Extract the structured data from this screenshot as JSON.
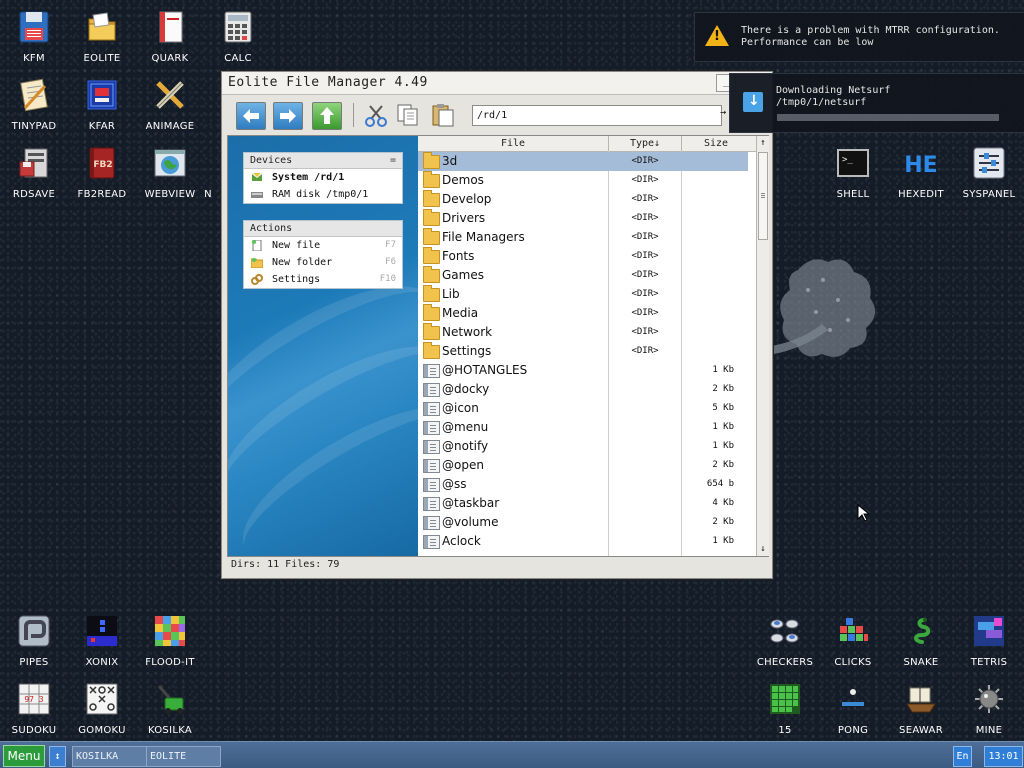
{
  "desktop": {
    "icons_top_left": [
      "KFM",
      "EOLITE",
      "QUARK",
      "CALC",
      "TINYPAD",
      "KFAR",
      "ANIMAGE",
      "RDSAVE",
      "FB2READ",
      "WEBVIEW",
      "N"
    ],
    "icons_top_right": [
      "SHELL",
      "HEXEDIT",
      "SYSPANEL"
    ],
    "icons_bottom_left": [
      "PIPES",
      "XONIX",
      "FLOOD-IT",
      "SUDOKU",
      "GOMOKU",
      "KOSILKA"
    ],
    "icons_bottom_right": [
      "CHECKERS",
      "CLICKS",
      "SNAKE",
      "TETRIS",
      "15",
      "PONG",
      "SEAWAR",
      "MINE"
    ],
    "hexedit_glyph": "HE",
    "fb2_glyph": "FB2",
    "sudoku_glyph": "97 3",
    "shell_glyph": ">_"
  },
  "window": {
    "title": "Eolite File Manager 4.49",
    "min_label": "_",
    "address": "/rd/1",
    "go_label": "→",
    "devices": {
      "header": "Devices",
      "mark": "=",
      "items": [
        {
          "label": "System /rd/1"
        },
        {
          "label": "RAM disk /tmp0/1"
        }
      ]
    },
    "actions": {
      "header": "Actions",
      "items": [
        {
          "label": "New file",
          "key": "F7"
        },
        {
          "label": "New folder",
          "key": "F6"
        },
        {
          "label": "Settings",
          "key": "F10"
        }
      ]
    },
    "columns": {
      "file": "File",
      "type": "Type↓",
      "size": "Size",
      "sort_btn": "↑"
    },
    "files": [
      {
        "name": "3d",
        "type": "<DIR>",
        "size": "",
        "kind": "dir",
        "selected": true
      },
      {
        "name": "Demos",
        "type": "<DIR>",
        "size": "",
        "kind": "dir"
      },
      {
        "name": "Develop",
        "type": "<DIR>",
        "size": "",
        "kind": "dir"
      },
      {
        "name": "Drivers",
        "type": "<DIR>",
        "size": "",
        "kind": "dir"
      },
      {
        "name": "File Managers",
        "type": "<DIR>",
        "size": "",
        "kind": "dir"
      },
      {
        "name": "Fonts",
        "type": "<DIR>",
        "size": "",
        "kind": "dir"
      },
      {
        "name": "Games",
        "type": "<DIR>",
        "size": "",
        "kind": "dir"
      },
      {
        "name": "Lib",
        "type": "<DIR>",
        "size": "",
        "kind": "dir"
      },
      {
        "name": "Media",
        "type": "<DIR>",
        "size": "",
        "kind": "dir"
      },
      {
        "name": "Network",
        "type": "<DIR>",
        "size": "",
        "kind": "dir"
      },
      {
        "name": "Settings",
        "type": "<DIR>",
        "size": "",
        "kind": "dir"
      },
      {
        "name": "@HOTANGLES",
        "type": "",
        "size": "1 Kb",
        "kind": "file"
      },
      {
        "name": "@docky",
        "type": "",
        "size": "2 Kb",
        "kind": "file"
      },
      {
        "name": "@icon",
        "type": "",
        "size": "5 Kb",
        "kind": "file"
      },
      {
        "name": "@menu",
        "type": "",
        "size": "1 Kb",
        "kind": "file"
      },
      {
        "name": "@notify",
        "type": "",
        "size": "1 Kb",
        "kind": "file"
      },
      {
        "name": "@open",
        "type": "",
        "size": "2 Kb",
        "kind": "file"
      },
      {
        "name": "@ss",
        "type": "",
        "size": "654 b",
        "kind": "file"
      },
      {
        "name": "@taskbar",
        "type": "",
        "size": "4 Kb",
        "kind": "file"
      },
      {
        "name": "@volume",
        "type": "",
        "size": "2 Kb",
        "kind": "file"
      },
      {
        "name": "Aclock",
        "type": "",
        "size": "1 Kb",
        "kind": "file"
      }
    ],
    "scroll_up": "↑",
    "scroll_down": "↓",
    "status": "Dirs: 11   Files: 79"
  },
  "notifications": [
    {
      "line1": "There is a problem with MTRR configuration.",
      "line2": "Performance can be low"
    },
    {
      "line1": "Downloading Netsurf",
      "line2": "/tmp0/1/netsurf",
      "progress": 0.0
    }
  ],
  "taskbar": {
    "menu": "Menu",
    "toggle": "↕",
    "tasks": [
      "KOSILKA",
      "EOLITE"
    ],
    "lang": "En",
    "clock": "13:01"
  },
  "colors": {
    "desktop_bg": "#141c28",
    "selection": "#a4bcd8",
    "panel_blue": "#1d7ab8",
    "menu_green": "#2b9b3c",
    "taskbar": "#4a6a93"
  }
}
